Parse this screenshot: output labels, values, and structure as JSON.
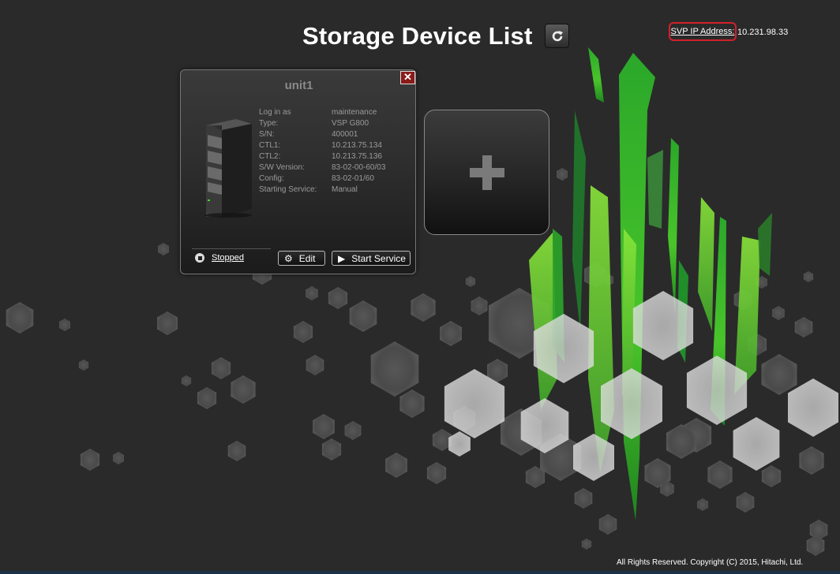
{
  "header": {
    "title": "Storage Device List",
    "svp_label": "SVP IP Address:",
    "svp_value": "10.231.98.33"
  },
  "unit": {
    "name": "unit1",
    "close_symbol": "✕",
    "info": [
      {
        "label": "Log in as",
        "value": "maintenance"
      },
      {
        "label": "Type:",
        "value": "VSP G800"
      },
      {
        "label": "S/N:",
        "value": "400001"
      },
      {
        "label": "CTL1:",
        "value": "10.213.75.134"
      },
      {
        "label": "CTL2:",
        "value": "10.213.75.136"
      },
      {
        "label": "S/W Version:",
        "value": "83-02-00-60/03"
      },
      {
        "label": "Config:",
        "value": "83-02-01/60"
      },
      {
        "label": "Starting Service:",
        "value": "Manual"
      }
    ],
    "status": "Stopped",
    "edit_label": "Edit",
    "start_label": "Start Service"
  },
  "icons": {
    "refresh": "refresh-icon",
    "close": "close-icon",
    "server": "server-rack-icon",
    "status": "stopped-icon",
    "edit": "gear-icon",
    "start": "play-icon",
    "add": "plus-icon"
  },
  "footer": {
    "copyright": "All Rights Reserved. Copyright (C) 2015, Hitachi, Ltd."
  },
  "colors": {
    "background": "#2a2a2a",
    "highlight": "#d2202a",
    "close": "#8b1a1a",
    "accent_green": "#4cd62a"
  }
}
